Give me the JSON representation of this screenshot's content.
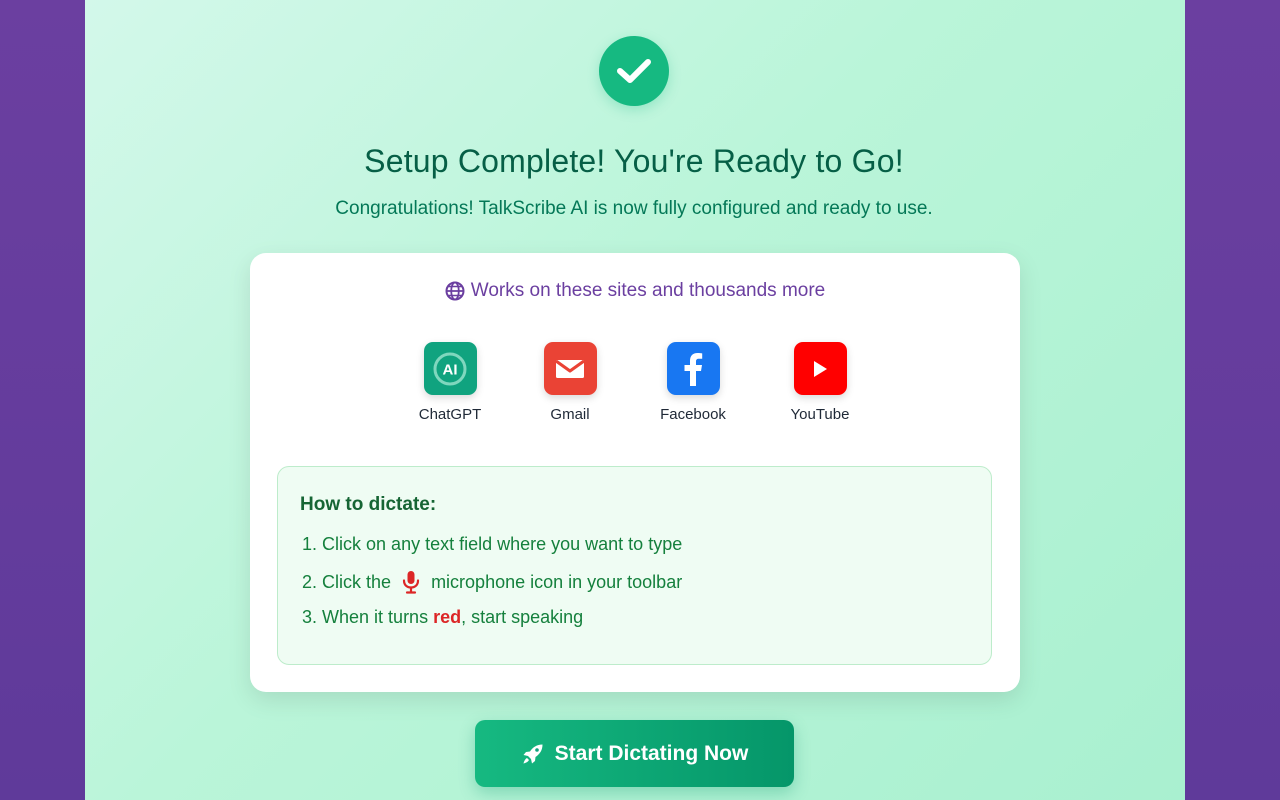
{
  "header": {
    "title": "Setup Complete! You're Ready to Go!",
    "subtitle": "Congratulations! TalkScribe AI is now fully configured and ready to use.",
    "success_icon": "check-icon"
  },
  "sites": {
    "heading": "Works on these sites and thousands more",
    "heading_icon": "globe-icon",
    "items": [
      {
        "label": "ChatGPT",
        "icon": "chatgpt-icon",
        "color": "#10a37f",
        "badge": "AI"
      },
      {
        "label": "Gmail",
        "icon": "gmail-icon",
        "color": "#ea4335"
      },
      {
        "label": "Facebook",
        "icon": "facebook-icon",
        "color": "#1877f2"
      },
      {
        "label": "YouTube",
        "icon": "youtube-icon",
        "color": "#ff0000"
      }
    ]
  },
  "howto": {
    "title": "How to dictate:",
    "steps": [
      {
        "number": "1.",
        "text": "Click on any text field where you want to type"
      },
      {
        "number": "2.",
        "before": "Click the",
        "icon": "microphone-icon",
        "after": "microphone icon in your toolbar"
      },
      {
        "number": "3.",
        "before": "When it turns",
        "highlight": "red",
        "after": ", start speaking"
      }
    ]
  },
  "cta": {
    "label": "Start Dictating Now",
    "icon": "rocket-icon"
  },
  "colors": {
    "accent": "#16b981",
    "brand_purple": "#6b3fa0",
    "highlight_red": "#dc2626"
  }
}
